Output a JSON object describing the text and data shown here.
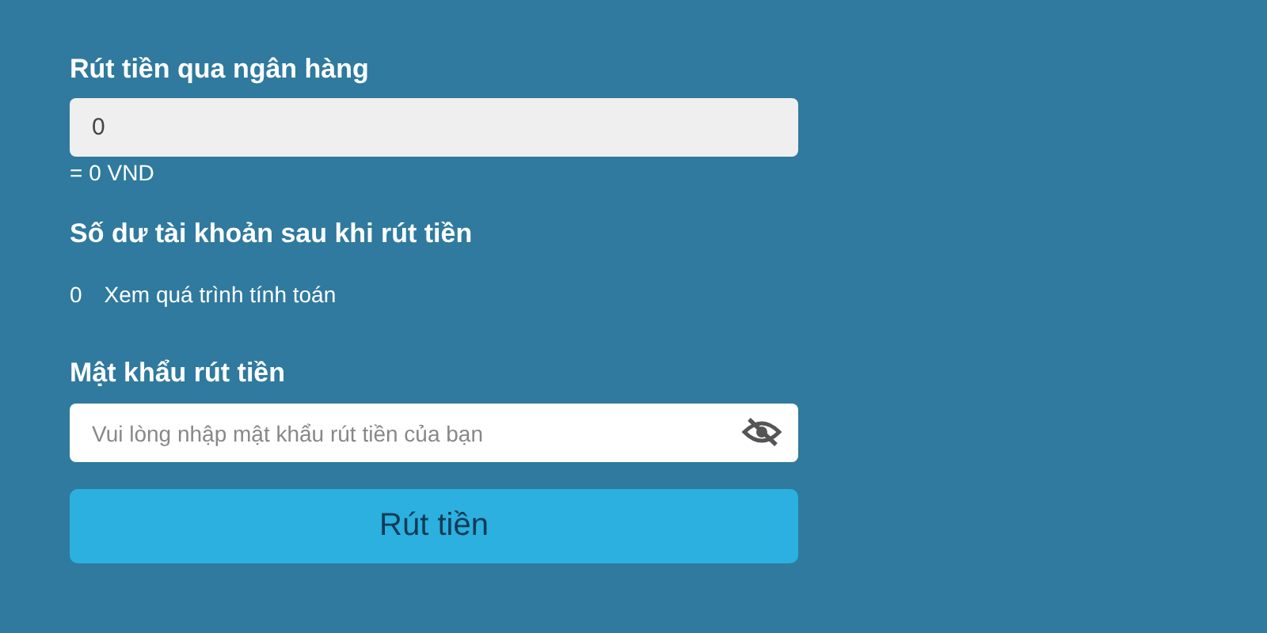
{
  "amount_section": {
    "title": "Rút tiền qua ngân hàng",
    "amount_field": {
      "value": "0"
    },
    "converted": "= 0 VND"
  },
  "balance_section": {
    "title": "Số dư tài khoản sau khi rút tiền",
    "balance": "0",
    "details_link": "Xem quá trình tính toán"
  },
  "password_section": {
    "label": "Mật khẩu rút tiền",
    "password_field": {
      "placeholder": "Vui lòng nhập mật khẩu rút tiền của bạn",
      "visible": false
    }
  },
  "submit_button": "Rút tiền"
}
